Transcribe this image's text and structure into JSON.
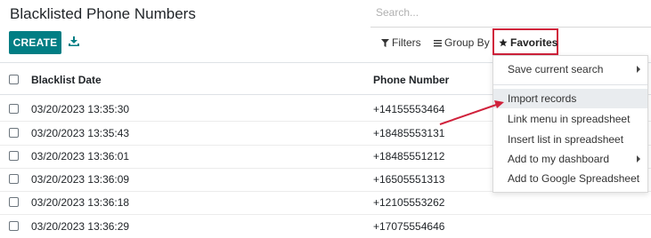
{
  "page_title": "Blacklisted Phone Numbers",
  "search": {
    "placeholder": "Search..."
  },
  "toolbar": {
    "create_label": "CREATE",
    "filters_label": "Filters",
    "groupby_label": "Group By",
    "favorites_label": "Favorites"
  },
  "table": {
    "columns": [
      "Blacklist Date",
      "Phone Number"
    ],
    "rows": [
      {
        "date": "03/20/2023 13:35:30",
        "phone": "+14155553464"
      },
      {
        "date": "03/20/2023 13:35:43",
        "phone": "+18485553131"
      },
      {
        "date": "03/20/2023 13:36:01",
        "phone": "+18485551212"
      },
      {
        "date": "03/20/2023 13:36:09",
        "phone": "+16505551313"
      },
      {
        "date": "03/20/2023 13:36:18",
        "phone": "+12105553262"
      },
      {
        "date": "03/20/2023 13:36:29",
        "phone": "+17075554646"
      }
    ]
  },
  "favorites_menu": {
    "items": [
      {
        "label": "Save current search",
        "submenu": true
      },
      {
        "label": "Import records",
        "submenu": false,
        "highlighted": true
      },
      {
        "label": "Link menu in spreadsheet",
        "submenu": false
      },
      {
        "label": "Insert list in spreadsheet",
        "submenu": false
      },
      {
        "label": "Add to my dashboard",
        "submenu": true
      },
      {
        "label": "Add to Google Spreadsheet",
        "submenu": false
      }
    ]
  },
  "colors": {
    "primary": "#017e84",
    "highlight_border": "#d0213b",
    "annotation_arrow": "#d0213b"
  },
  "icons": [
    "download-icon",
    "filter-icon",
    "group-by-icon",
    "star-icon",
    "caret-right-icon",
    "annotation-arrow"
  ]
}
